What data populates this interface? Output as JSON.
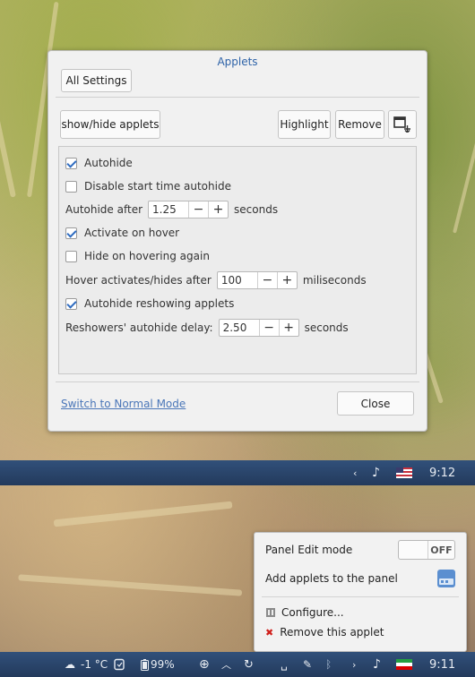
{
  "dialog": {
    "title": "Applets",
    "all_settings": "All Settings",
    "show_hide": "show/hide applets",
    "highlight": "Highlight",
    "remove": "Remove",
    "options": {
      "autohide": {
        "label": "Autohide",
        "checked": true
      },
      "disable_start": {
        "label": "Disable start time autohide",
        "checked": false
      },
      "autohide_after": {
        "label": "Autohide after",
        "value": "1.25",
        "unit": "seconds"
      },
      "activate_hover": {
        "label": "Activate on hover",
        "checked": true
      },
      "hide_hover": {
        "label": "Hide on hovering again",
        "checked": false
      },
      "hover_after": {
        "label": "Hover activates/hides after",
        "value": "100",
        "unit": "miliseconds"
      },
      "autohide_reshowing": {
        "label": "Autohide reshowing applets",
        "checked": true
      },
      "reshowers_delay": {
        "label": "Reshowers' autohide delay:",
        "value": "2.50",
        "unit": "seconds"
      }
    },
    "minus": "−",
    "plus": "+",
    "switch_link": "Switch to Normal Mode",
    "close": "Close"
  },
  "panel_top": {
    "time": "9:12"
  },
  "menu": {
    "edit_mode": "Panel Edit mode",
    "toggle_state": "OFF",
    "add_applets": "Add applets to the panel",
    "configure": "Configure...",
    "remove_applet": "Remove this applet"
  },
  "panel_bottom": {
    "temperature": "-1 °C",
    "battery": "99%",
    "time": "9:11"
  },
  "colors": {
    "panel": "#2a4468",
    "link": "#4a76b8",
    "title": "#2e63a8",
    "check": "#2f6cc0"
  }
}
